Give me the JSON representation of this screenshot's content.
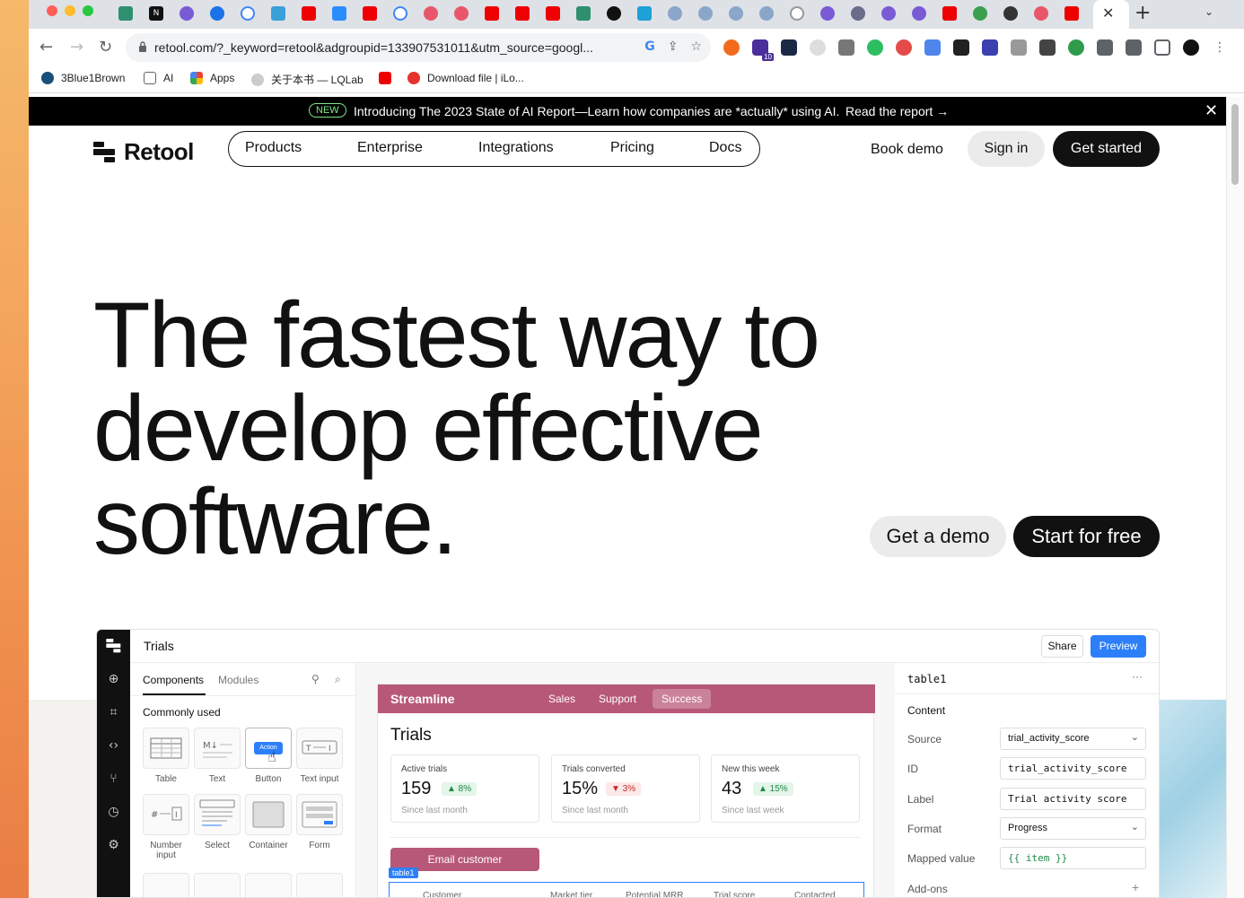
{
  "browser": {
    "url": "retool.com/?_keyword=retool&adgroupid=133907531011&utm_source=googl...",
    "ext_badge": "10",
    "bookmarks": [
      "3Blue1Brown",
      "AI",
      "Apps",
      "关于本书 — LQLab",
      "Download file | iLo..."
    ]
  },
  "banner": {
    "badge": "NEW",
    "text": "Introducing The 2023 State of AI Report—Learn how companies are *actually* using AI.",
    "link": "Read the report →"
  },
  "header": {
    "logo": "Retool",
    "nav": [
      "Products",
      "Enterprise",
      "Integrations",
      "Pricing",
      "Docs"
    ],
    "book_demo": "Book demo",
    "sign_in": "Sign in",
    "get_started": "Get started"
  },
  "hero": {
    "line1": "The fastest way to",
    "line2": "develop effective",
    "line3": "software.",
    "cta_demo": "Get a demo",
    "cta_free": "Start for free"
  },
  "app": {
    "title": "Trials",
    "share": "Share",
    "preview": "Preview",
    "left_tabs": [
      "Components",
      "Modules"
    ],
    "commonly_used": "Commonly used",
    "components": [
      "Table",
      "Text",
      "Button",
      "Text input",
      "Number input",
      "Select",
      "Container",
      "Form"
    ],
    "button_preview": "Action",
    "streamline": {
      "logo": "Streamline",
      "nav": [
        "Sales",
        "Support",
        "Success"
      ],
      "heading": "Trials",
      "stats": [
        {
          "label": "Active trials",
          "value": "159",
          "delta": "▲ 8%",
          "sub": "Since last month"
        },
        {
          "label": "Trials converted",
          "value": "15%",
          "delta": "▼ 3%",
          "sub": "Since last month"
        },
        {
          "label": "New this week",
          "value": "43",
          "delta": "▲ 15%",
          "sub": "Since last week"
        }
      ],
      "email_button": "Email customer",
      "table_tag": "table1",
      "columns": [
        "Customer",
        "Market tier",
        "Potential MRR",
        "Trial score",
        "Contacted"
      ]
    },
    "inspector": {
      "title": "table1",
      "dots": "···",
      "section": "Content",
      "rows": [
        {
          "label": "Source",
          "value": "trial_activity_score"
        },
        {
          "label": "ID",
          "value": "trial_activity_score"
        },
        {
          "label": "Label",
          "value": "Trial activity score"
        },
        {
          "label": "Format",
          "value": "Progress"
        },
        {
          "label": "Mapped value",
          "value": "{{ item }}"
        },
        {
          "label": "Add-ons",
          "value": ""
        }
      ]
    }
  }
}
